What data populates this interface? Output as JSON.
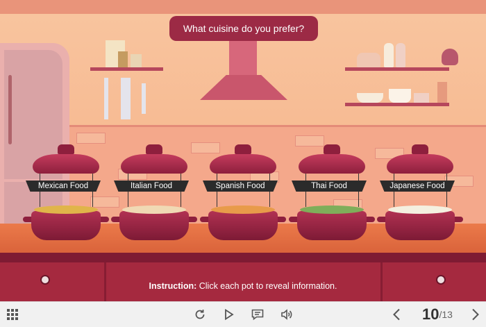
{
  "question": "What cuisine do you prefer?",
  "pots": [
    {
      "label": "Mexican Food",
      "food_color": "#e0b54a"
    },
    {
      "label": "Italian Food",
      "food_color": "#f0d9b4"
    },
    {
      "label": "Spanish Food",
      "food_color": "#e89b4a"
    },
    {
      "label": "Thai Food",
      "food_color": "#7fae5a"
    },
    {
      "label": "Japanese Food",
      "food_color": "#f4f0e0"
    }
  ],
  "instruction": {
    "prefix": "Instruction:",
    "text": "Click each pot to reveal information."
  },
  "toolbar": {
    "icons": [
      "menu-grid-icon",
      "replay-icon",
      "play-icon",
      "comment-icon",
      "volume-icon",
      "prev-icon",
      "next-icon"
    ],
    "current_page": "10",
    "total_pages": "/13"
  },
  "colors": {
    "accent": "#9c2a45",
    "pot": "#a8284a",
    "counter": "#e0703f"
  }
}
